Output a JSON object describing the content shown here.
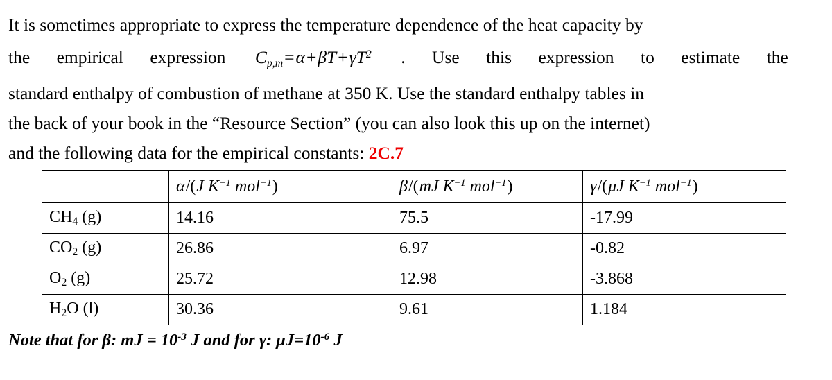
{
  "document": {
    "paragraph": {
      "line1": "It is sometimes appropriate to express the temperature dependence of the heat capacity by",
      "line2_prefix": "the",
      "line2_word2": "empirical",
      "line2_word3": "expression",
      "line2_suffix_a": ".",
      "line2_suffix_b": "Use",
      "line2_suffix_c": "this",
      "line2_suffix_d": "expression",
      "line2_suffix_e": "to",
      "line2_suffix_f": "estimate",
      "line2_suffix_g": "the",
      "line3": "standard enthalpy of combustion of methane at 350 K. Use the standard enthalpy tables in",
      "line4": "the back of your book in the “Resource Section” (you can also look this up on the internet)",
      "line5": "and the following data for the empirical constants:",
      "reference_label": "2C.7"
    },
    "formula": {
      "symbol": "C",
      "subscript": "p,m",
      "equals": "=",
      "term1": "α",
      "plus1": "+",
      "term2_coef": "β",
      "term2_var": "T",
      "plus2": "+",
      "term3_coef": "γ",
      "term3_var": "T",
      "term3_exp": "2"
    }
  },
  "table": {
    "headers": {
      "corner": "",
      "alpha": {
        "symbol": "α",
        "slash": "/(",
        "unit_j": "J",
        "unit_k": "K",
        "k_exp": "−1",
        "unit_mol": "mol",
        "mol_exp": "−1",
        "close": ")"
      },
      "beta": {
        "symbol": "β",
        "slash": "/(",
        "unit_j": "mJ",
        "unit_k": "K",
        "k_exp": "−1",
        "unit_mol": "mol",
        "mol_exp": "−1",
        "close": ")"
      },
      "gamma": {
        "symbol": "γ",
        "slash": "/(",
        "unit_j": "μJ",
        "unit_k": "K",
        "k_exp": "−1",
        "unit_mol": "mol",
        "mol_exp": "−1",
        "close": ")"
      }
    },
    "rows": [
      {
        "species_main": "CH",
        "species_sub": "4",
        "species_state": " (g)",
        "alpha": "14.16",
        "beta": "75.5",
        "gamma": "-17.99"
      },
      {
        "species_main": "CO",
        "species_sub": "2",
        "species_state": " (g)",
        "alpha": "26.86",
        "beta": "6.97",
        "gamma": "-0.82"
      },
      {
        "species_main": "O",
        "species_sub": "2",
        "species_state": " (g)",
        "alpha": "25.72",
        "beta": "12.98",
        "gamma": "-3.868"
      },
      {
        "species_main": "H",
        "species_sub": "2",
        "species_state": "O (l)",
        "alpha": "30.36",
        "beta": "9.61",
        "gamma": "1.184"
      }
    ]
  },
  "note": {
    "part1": "Note that for β: mJ = 10",
    "exp1": "-3",
    "part2": " J and for γ: μJ=10",
    "exp2": "-6",
    "part3": " J"
  },
  "colors": {
    "text": "#000000",
    "reference_red": "#ee0000",
    "table_border": "#000000",
    "background": "#ffffff"
  }
}
